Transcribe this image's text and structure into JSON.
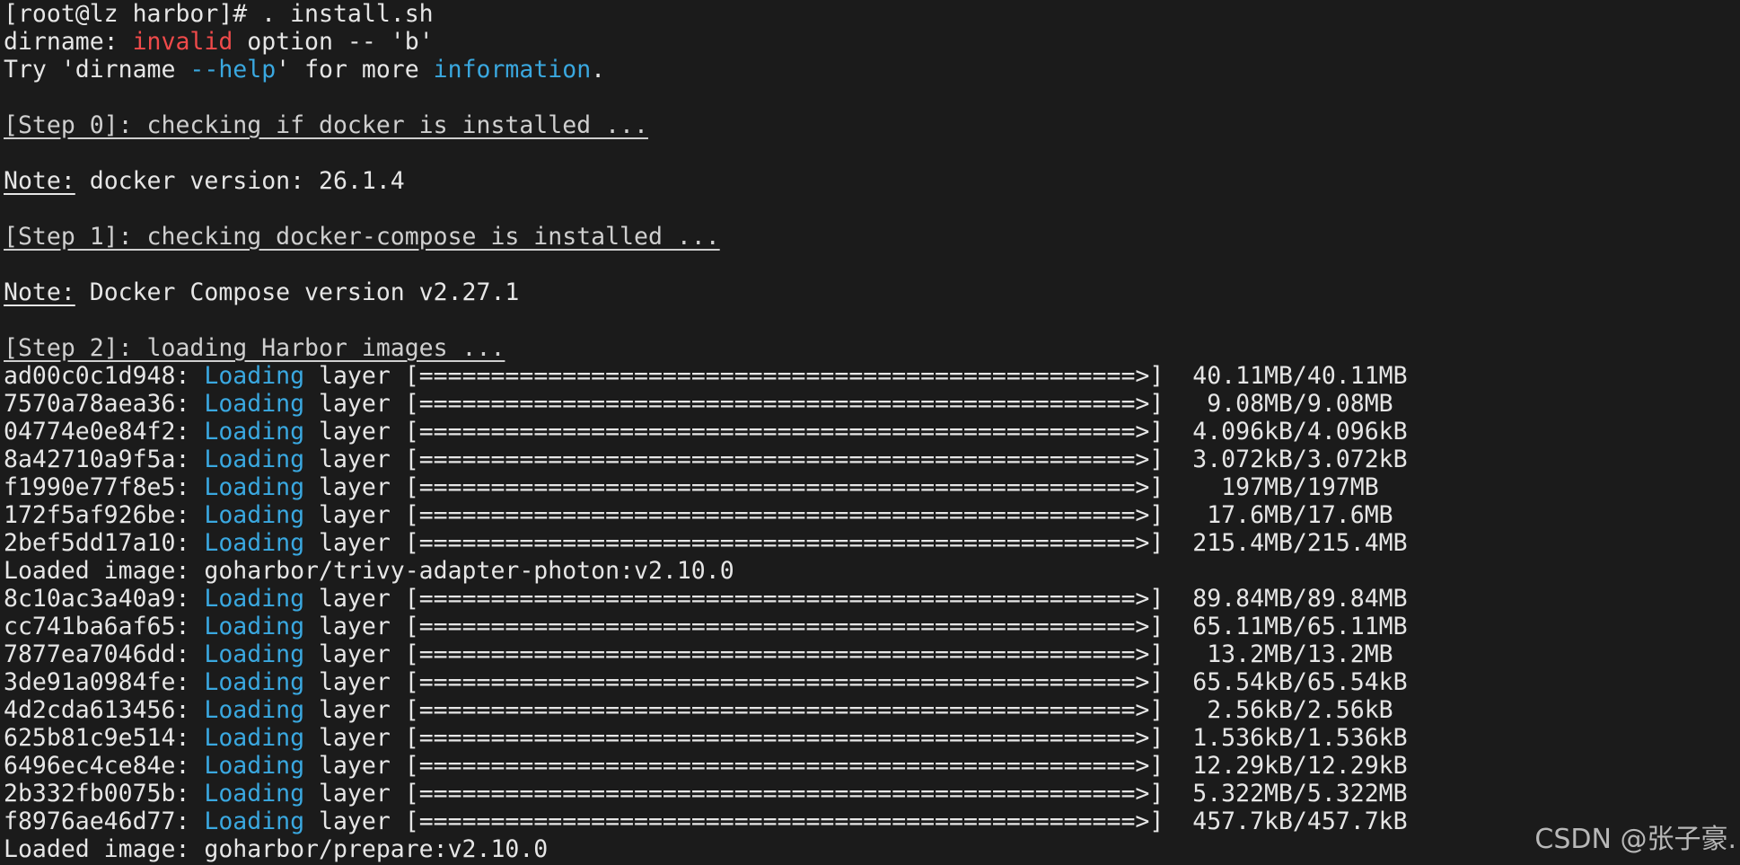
{
  "terminal": {
    "prompt": "[root@lz harbor]# . install.sh",
    "dirname_err": {
      "prefix": "dirname: ",
      "invalid": "invalid",
      "suffix": " option -- 'b'"
    },
    "try_line": {
      "prefix": "Try 'dirname ",
      "help": "--help",
      "middle": "' for more ",
      "information": "information",
      "end": "."
    },
    "step0": "[Step 0]: checking if docker is installed ...",
    "note0": {
      "label": "Note:",
      "text": " docker version: 26.1.4"
    },
    "step1": "[Step 1]: checking docker-compose is installed ...",
    "note1": {
      "label": "Note:",
      "text": " Docker Compose version v2.27.1"
    },
    "step2": "[Step 2]: loading Harbor images ...",
    "loading_word": "Loading",
    "layer_word": " layer ",
    "bar": "[==================================================>]",
    "layers_a": [
      {
        "id": "ad00c0c1d948",
        "size": "  40.11MB/40.11MB"
      },
      {
        "id": "7570a78aea36",
        "size": "   9.08MB/9.08MB"
      },
      {
        "id": "04774e0e84f2",
        "size": "  4.096kB/4.096kB"
      },
      {
        "id": "8a42710a9f5a",
        "size": "  3.072kB/3.072kB"
      },
      {
        "id": "f1990e77f8e5",
        "size": "    197MB/197MB"
      },
      {
        "id": "172f5af926be",
        "size": "   17.6MB/17.6MB"
      },
      {
        "id": "2bef5dd17a10",
        "size": "  215.4MB/215.4MB"
      }
    ],
    "loaded_a": "Loaded image: goharbor/trivy-adapter-photon:v2.10.0",
    "layers_b": [
      {
        "id": "8c10ac3a40a9",
        "size": "  89.84MB/89.84MB"
      },
      {
        "id": "cc741ba6af65",
        "size": "  65.11MB/65.11MB"
      },
      {
        "id": "7877ea7046dd",
        "size": "   13.2MB/13.2MB"
      },
      {
        "id": "3de91a0984fe",
        "size": "  65.54kB/65.54kB"
      },
      {
        "id": "4d2cda613456",
        "size": "   2.56kB/2.56kB"
      },
      {
        "id": "625b81c9e514",
        "size": "  1.536kB/1.536kB"
      },
      {
        "id": "6496ec4ce84e",
        "size": "  12.29kB/12.29kB"
      },
      {
        "id": "2b332fb0075b",
        "size": "  5.322MB/5.322MB"
      },
      {
        "id": "f8976ae46d77",
        "size": "  457.7kB/457.7kB"
      }
    ],
    "loaded_b": "Loaded image: goharbor/prepare:v2.10.0"
  },
  "watermark": "CSDN @张子豪.",
  "colors": {
    "background": "#1b1b1b",
    "text": "#e6e6e6",
    "error": "#ef4a4a",
    "keyword": "#3aa8e0"
  }
}
